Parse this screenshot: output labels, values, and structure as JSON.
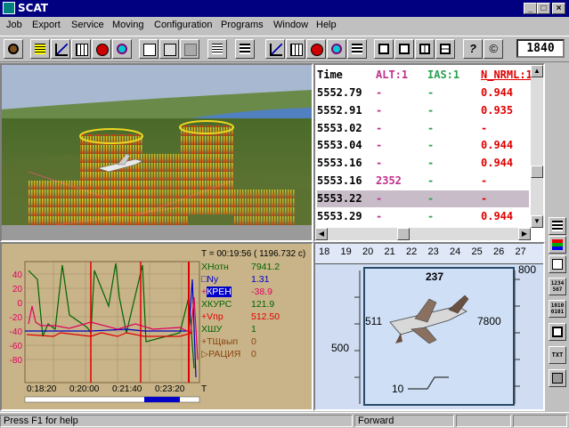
{
  "window": {
    "title": "SCAT",
    "min": "_",
    "max": "□",
    "close": "×"
  },
  "menu": [
    "Job",
    "Export",
    "Service",
    "Moving",
    "Configuration",
    "Programs",
    "Window",
    "Help"
  ],
  "toolbar": {
    "frame_value": "1840"
  },
  "table": {
    "headers": [
      "Time",
      "ALT:1",
      "IAS:1",
      "N_NRML:1"
    ],
    "header_colors": [
      "#000000",
      "#c0308a",
      "#2aa050",
      "#e00000"
    ],
    "rows": [
      [
        "5552.79",
        "-",
        "-",
        "0.944"
      ],
      [
        "5552.91",
        "-",
        "-",
        "0.935"
      ],
      [
        "5553.02",
        "-",
        "-",
        "-"
      ],
      [
        "5553.04",
        "-",
        "-",
        "0.944"
      ],
      [
        "5553.16",
        "-",
        "-",
        "0.944"
      ],
      [
        "5553.16",
        "2352",
        "-",
        "-"
      ],
      [
        "5553.22",
        "-",
        "-",
        "-"
      ],
      [
        "5553.29",
        "-",
        "-",
        "0.944"
      ]
    ],
    "selected_row": 6
  },
  "trace": {
    "time_readout": "T = 00:19:56 ( 1196.732 c)",
    "y_ticks": [
      "40",
      "20",
      "0",
      "-20",
      "-40",
      "-60",
      "-80"
    ],
    "x_ticks": [
      "0:18:20",
      "0:20:00",
      "0:21:40",
      "0:23:20"
    ],
    "x_axis_label": "T",
    "legend": [
      {
        "marker": "X",
        "label": "Нотн",
        "value": "7941.2",
        "color": "#006400"
      },
      {
        "marker": "□",
        "label": "Ny",
        "value": "1.31",
        "color": "#0000c8"
      },
      {
        "marker": "+",
        "label": "КРЕН",
        "value": "-38.9",
        "color": "#e00060",
        "highlight": true
      },
      {
        "marker": "X",
        "label": "КУРС",
        "value": "121.9",
        "color": "#006400"
      },
      {
        "marker": "+",
        "label": "Vпр",
        "value": "512.50",
        "color": "#e00000"
      },
      {
        "marker": "X",
        "label": "ШУ",
        "value": "1",
        "color": "#006400"
      },
      {
        "marker": "+",
        "label": "ТЩвып",
        "value": "0",
        "color": "#8b4513"
      },
      {
        "marker": "▷",
        "label": "РАЦИЯ",
        "value": "0",
        "color": "#8b4513"
      }
    ]
  },
  "hud": {
    "heading_ticks": [
      "18",
      "19",
      "20",
      "21",
      "22",
      "23",
      "24",
      "25",
      "26",
      "27"
    ],
    "heading_value": "237",
    "speed_value": "511",
    "speed_scale": "500",
    "altitude_value": "7800",
    "altitude_scale": "800",
    "pitch_value": "10"
  },
  "side_buttons": [
    "",
    "",
    "",
    "1234\n567",
    "1010\n0101",
    "",
    "TXT",
    ""
  ],
  "status": {
    "help": "Press F1 for help",
    "mode": "Forward"
  }
}
